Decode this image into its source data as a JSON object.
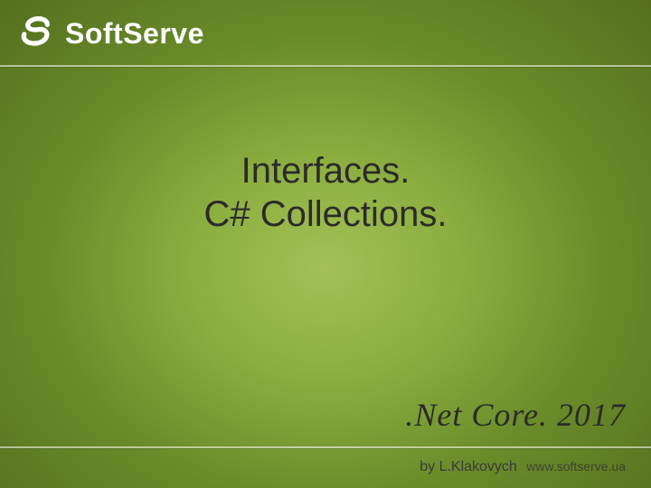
{
  "brand": {
    "name": "SoftServe"
  },
  "title": {
    "line1": "Interfaces.",
    "line2": "C# Collections."
  },
  "subtitle": ".Net Core. 2017",
  "credits": {
    "by": "by L.Klakovych",
    "url": "www.softserve.ua"
  }
}
